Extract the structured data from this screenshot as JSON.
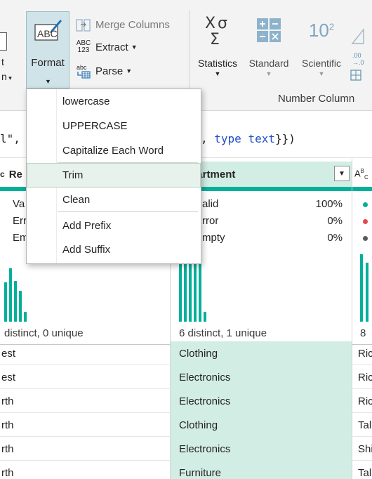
{
  "ribbon": {
    "left_fragment_line1": "t",
    "left_fragment_line2": "n",
    "format": {
      "label": "Format",
      "icon": "abc-format-icon"
    },
    "merge_columns": {
      "label": "Merge Columns",
      "icon": "merge-columns-icon"
    },
    "extract": {
      "label": "Extract",
      "icon_text": "ABC 123",
      "icon": "extract-icon"
    },
    "parse": {
      "label": "Parse",
      "icon_text": "abc",
      "icon": "parse-icon"
    },
    "statistics": {
      "label": "Statistics",
      "icon": "sigma-icon",
      "icon_text": "XΣ"
    },
    "standard": {
      "label": "Standard",
      "icon": "calculator-icon"
    },
    "scientific": {
      "label": "Scientific",
      "icon": "ten-squared-icon",
      "icon_text": "10",
      "icon_sup": "2"
    },
    "rounding_icon_text": ".00 →.0",
    "group_label": "Number Column"
  },
  "formula": {
    "left_text": "l\",",
    "right_keyword": "type",
    "right_type": "text",
    "right_close": "}})",
    "right_comma": ","
  },
  "menu": {
    "items": [
      {
        "label": "lowercase"
      },
      {
        "label": "UPPERCASE"
      },
      {
        "label": "Capitalize Each Word"
      },
      {
        "label": "Trim",
        "hovered": true
      },
      {
        "label": "Clean"
      },
      {
        "label": "Add Prefix"
      },
      {
        "label": "Add Suffix"
      }
    ]
  },
  "columns": {
    "region": {
      "header": "Re",
      "type_icon": "ABC",
      "stats": {
        "valid_label": "Va",
        "error_label": "Err",
        "empty_label": "Em"
      },
      "distinct": "distinct, 0 unique"
    },
    "department": {
      "header": "Department",
      "type_icon": "ABC",
      "stats": {
        "valid_label": "alid",
        "valid_value": "100%",
        "error_label": "rror",
        "error_value": "0%",
        "empty_label": "mpty",
        "empty_value": "0%"
      },
      "distinct": "6 distinct, 1 unique"
    },
    "next": {
      "header_icon": "ABC",
      "distinct": "8"
    }
  },
  "rows": [
    {
      "region": "est",
      "department": "Clothing",
      "next": "Ric"
    },
    {
      "region": "est",
      "department": "Electronics",
      "next": "Ric"
    },
    {
      "region": "rth",
      "department": "Electronics",
      "next": "Ric"
    },
    {
      "region": "rth",
      "department": "Clothing",
      "next": "Tal"
    },
    {
      "region": "rth",
      "department": "Electronics",
      "next": "Shi"
    },
    {
      "region": "rth",
      "department": "Furniture",
      "next": "Tal"
    }
  ],
  "colors": {
    "accent": "#00b09b",
    "highlight": "#d2ede4",
    "valid_dot": "#00b09b",
    "error_dot": "#e8484d",
    "empty_dot": "#5a5a5a"
  }
}
